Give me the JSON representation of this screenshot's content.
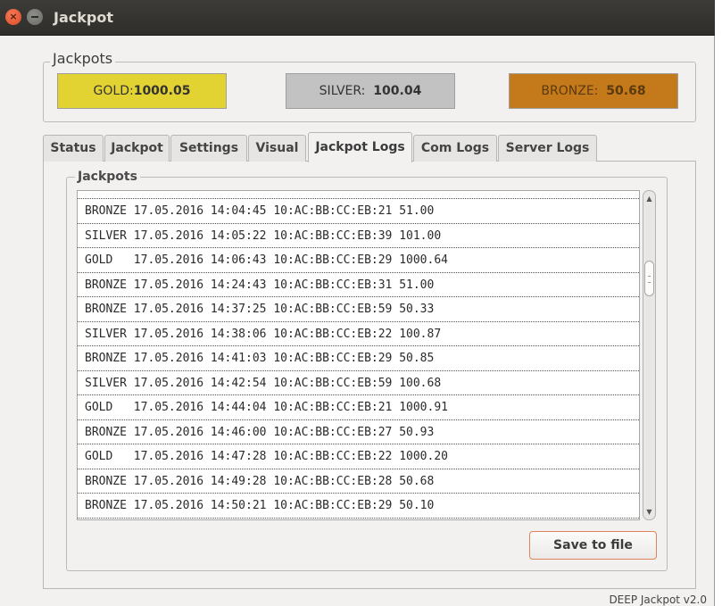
{
  "window": {
    "title": "Jackpot",
    "close_glyph": "×"
  },
  "jackpots": {
    "legend": "Jackpots",
    "gold": {
      "label": "GOLD:",
      "value": "1000.05"
    },
    "silver": {
      "label": "SILVER:",
      "value": "100.04"
    },
    "bronze": {
      "label": "BRONZE:",
      "value": "50.68"
    },
    "colors": {
      "gold": "#e2d333",
      "silver": "#c2c2c2",
      "bronze": "#c4791a"
    }
  },
  "tabs": [
    {
      "label": "Status",
      "active": false
    },
    {
      "label": "Jackpot",
      "active": false
    },
    {
      "label": "Settings",
      "active": false
    },
    {
      "label": "Visual",
      "active": false
    },
    {
      "label": "Jackpot Logs",
      "active": true
    },
    {
      "label": "Com Logs",
      "active": false
    },
    {
      "label": "Server Logs",
      "active": false
    }
  ],
  "logs": {
    "legend": "Jackpots",
    "rows": [
      "BRONZE 17.05.2016 14:04:45 10:AC:BB:CC:EB:21 51.00",
      "SILVER 17.05.2016 14:05:22 10:AC:BB:CC:EB:39 101.00",
      "GOLD   17.05.2016 14:06:43 10:AC:BB:CC:EB:29 1000.64",
      "BRONZE 17.05.2016 14:24:43 10:AC:BB:CC:EB:31 51.00",
      "BRONZE 17.05.2016 14:37:25 10:AC:BB:CC:EB:59 50.33",
      "SILVER 17.05.2016 14:38:06 10:AC:BB:CC:EB:22 100.87",
      "BRONZE 17.05.2016 14:41:03 10:AC:BB:CC:EB:29 50.85",
      "SILVER 17.05.2016 14:42:54 10:AC:BB:CC:EB:59 100.68",
      "GOLD   17.05.2016 14:44:04 10:AC:BB:CC:EB:21 1000.91",
      "BRONZE 17.05.2016 14:46:00 10:AC:BB:CC:EB:27 50.93",
      "GOLD   17.05.2016 14:47:28 10:AC:BB:CC:EB:22 1000.20",
      "BRONZE 17.05.2016 14:49:28 10:AC:BB:CC:EB:28 50.68",
      "BRONZE 17.05.2016 14:50:21 10:AC:BB:CC:EB:29 50.10"
    ],
    "save_label": "Save to file"
  },
  "footer": {
    "version": "DEEP Jackpot v2.0"
  }
}
